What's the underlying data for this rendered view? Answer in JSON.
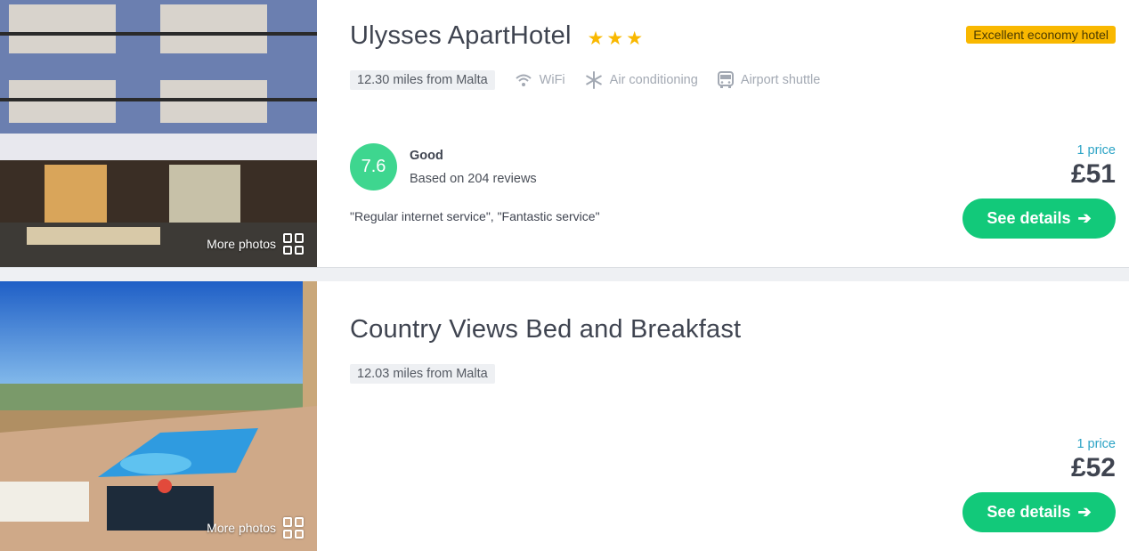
{
  "hotels": [
    {
      "name": "Ulysses ApartHotel",
      "stars": [
        "★",
        "★",
        "★"
      ],
      "tag": "Excellent economy hotel",
      "distance": "12.30 miles from Malta",
      "amenities": [
        {
          "icon": "wifi-icon",
          "label": "WiFi"
        },
        {
          "icon": "snowflake-icon",
          "label": "Air conditioning"
        },
        {
          "icon": "bus-icon",
          "label": "Airport shuttle"
        }
      ],
      "score": "7.6",
      "rating_word": "Good",
      "rating_count": "Based on 204 reviews",
      "quote": "\"Regular internet service\", \"Fantastic service\"",
      "price_count": "1 price",
      "price": "£51",
      "button": "See details",
      "more_photos": "More photos"
    },
    {
      "name": "Country Views Bed and Breakfast",
      "distance": "12.03 miles from Malta",
      "price_count": "1 price",
      "price": "£52",
      "button": "See details",
      "more_photos": "More photos"
    }
  ],
  "colors": {
    "accent_green": "#12c97a",
    "score_green": "#3ed68f",
    "tag_yellow": "#f9b800",
    "price_link_blue": "#2ba3c5"
  }
}
